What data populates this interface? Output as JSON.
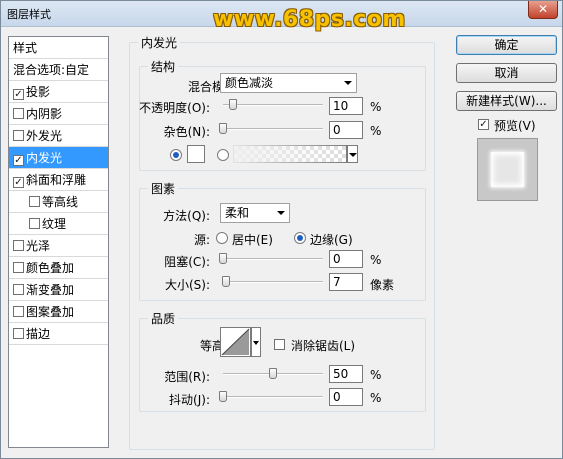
{
  "window": {
    "title": "图层样式",
    "watermark": "www.68ps.com",
    "close_label": "✕"
  },
  "styles_list": {
    "header": "样式",
    "blend_options": "混合选项:自定",
    "items": [
      {
        "label": "投影",
        "checked": true,
        "selected": false,
        "indent": false
      },
      {
        "label": "内阴影",
        "checked": false,
        "selected": false,
        "indent": false
      },
      {
        "label": "外发光",
        "checked": false,
        "selected": false,
        "indent": false
      },
      {
        "label": "内发光",
        "checked": true,
        "selected": true,
        "indent": false
      },
      {
        "label": "斜面和浮雕",
        "checked": true,
        "selected": false,
        "indent": false
      },
      {
        "label": "等高线",
        "checked": false,
        "selected": false,
        "indent": true
      },
      {
        "label": "纹理",
        "checked": false,
        "selected": false,
        "indent": true
      },
      {
        "label": "光泽",
        "checked": false,
        "selected": false,
        "indent": false
      },
      {
        "label": "颜色叠加",
        "checked": false,
        "selected": false,
        "indent": false
      },
      {
        "label": "渐变叠加",
        "checked": false,
        "selected": false,
        "indent": false
      },
      {
        "label": "图案叠加",
        "checked": false,
        "selected": false,
        "indent": false
      },
      {
        "label": "描边",
        "checked": false,
        "selected": false,
        "indent": false
      }
    ]
  },
  "inner_glow": {
    "title": "内发光",
    "structure": {
      "title": "结构",
      "blend_mode_label": "混合模式:",
      "blend_mode_value": "颜色减淡",
      "opacity_label": "不透明度(O):",
      "opacity_value": "10",
      "opacity_fraction": 0.1,
      "opacity_unit": "%",
      "noise_label": "杂色(N):",
      "noise_value": "0",
      "noise_fraction": 0.0,
      "noise_unit": "%",
      "color_mode": "solid"
    },
    "elements": {
      "title": "图素",
      "technique_label": "方法(Q):",
      "technique_value": "柔和",
      "source_label": "源:",
      "source_center": "居中(E)",
      "source_edge": "边缘(G)",
      "choke_label": "阻塞(C):",
      "choke_value": "0",
      "choke_fraction": 0.0,
      "choke_unit": "%",
      "size_label": "大小(S):",
      "size_value": "7",
      "size_fraction": 0.028,
      "size_unit": "像素"
    },
    "quality": {
      "title": "品质",
      "contour_label": "等高线:",
      "antialias_label": "消除锯齿(L)",
      "range_label": "范围(R):",
      "range_value": "50",
      "range_fraction": 0.5,
      "range_unit": "%",
      "jitter_label": "抖动(J):",
      "jitter_value": "0",
      "jitter_fraction": 0.0,
      "jitter_unit": "%"
    }
  },
  "buttons": {
    "ok": "确定",
    "cancel": "取消",
    "new_style": "新建样式(W)...",
    "preview_label": "预览(V)",
    "preview_checked": true
  },
  "colors": {
    "selection": "#3399ff",
    "watermark": "#f6c200"
  }
}
